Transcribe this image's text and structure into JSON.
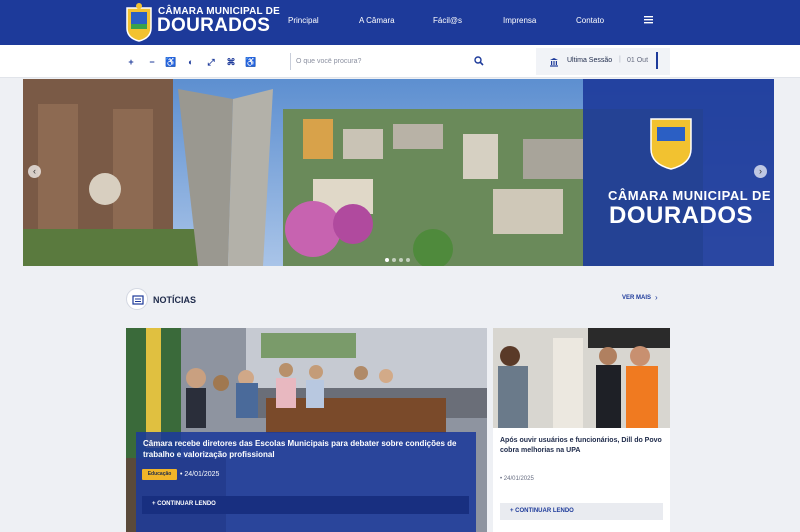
{
  "header": {
    "brand_small": "CÂMARA MUNICIPAL DE",
    "brand_big": "DOURADOS",
    "nav": [
      "Principal",
      "A Câmara",
      "Fácil@s",
      "Imprensa",
      "Contato"
    ],
    "accent": "#1d3a9a"
  },
  "toolbar": {
    "accessibility": [
      "+",
      "−",
      "♿",
      "◐",
      "⤢",
      "⌘",
      "♿"
    ],
    "search_placeholder": "O que você procura?",
    "session_label": "Ultima Sessão",
    "session_sep": "|",
    "session_date": "01 Out"
  },
  "banner": {
    "brand_small": "CÂMARA MUNICIPAL DE",
    "brand_big": "DOURADOS",
    "prev": "‹",
    "next": "›"
  },
  "news": {
    "title": "NOTÍCIAS",
    "see_more": "VER MAIS",
    "main": {
      "headline": "Câmara recebe diretores das Escolas Municipais para debater sobre condições de trabalho e valorização profissional",
      "tag": "Educação",
      "date": "24/01/2025",
      "continue": "+ CONTINUAR LENDO"
    },
    "side": {
      "headline": "Após ouvir usuários e funcionários, Dill do Povo cobra melhorias na UPA",
      "date": "24/01/2025",
      "continue": "+ CONTINUAR LENDO"
    }
  }
}
